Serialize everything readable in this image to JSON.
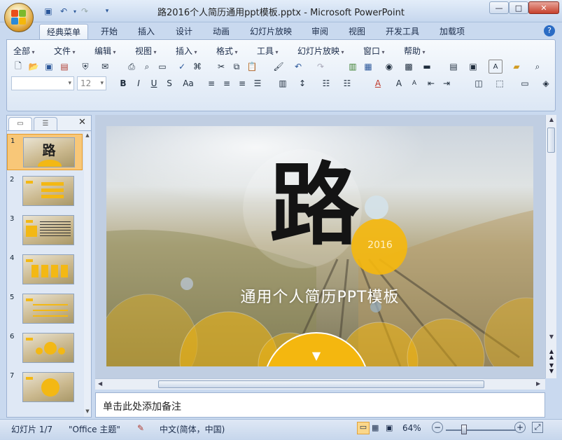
{
  "window": {
    "title": "路2016个人简历通用ppt模板.pptx - Microsoft PowerPoint",
    "minimize": "—",
    "maximize": "□",
    "close": "✕"
  },
  "ribbon_tabs": [
    "经典菜单",
    "开始",
    "插入",
    "设计",
    "动画",
    "幻灯片放映",
    "审阅",
    "视图",
    "开发工具",
    "加载项"
  ],
  "menus": [
    "全部",
    "文件",
    "编辑",
    "视图",
    "插入",
    "格式",
    "工具",
    "幻灯片放映",
    "窗口",
    "帮助"
  ],
  "font_size_value": "12",
  "format_buttons": [
    "B",
    "I",
    "U",
    "S",
    "Aa"
  ],
  "thumbnails": [
    {
      "num": "1",
      "text": "路",
      "selected": true
    },
    {
      "num": "2",
      "text": "",
      "selected": false
    },
    {
      "num": "3",
      "text": "",
      "selected": false
    },
    {
      "num": "4",
      "text": "",
      "selected": false
    },
    {
      "num": "5",
      "text": "",
      "selected": false
    },
    {
      "num": "6",
      "text": "",
      "selected": false
    },
    {
      "num": "7",
      "text": "",
      "selected": false
    }
  ],
  "slide": {
    "big_char": "路",
    "year": "2016",
    "subtitle": "通用个人简历PPT模板",
    "arrow": "▼"
  },
  "notes_placeholder": "单击此处添加备注",
  "status": {
    "slide_info": "幻灯片 1/7",
    "theme": "\"Office 主题\"",
    "language": "中文(简体，中国)",
    "zoom": "64%"
  },
  "colors": {
    "accent_yellow": "#f4b70f",
    "ribbon_blue": "#c9d9ef",
    "selected_thumb": "#f8c778"
  }
}
